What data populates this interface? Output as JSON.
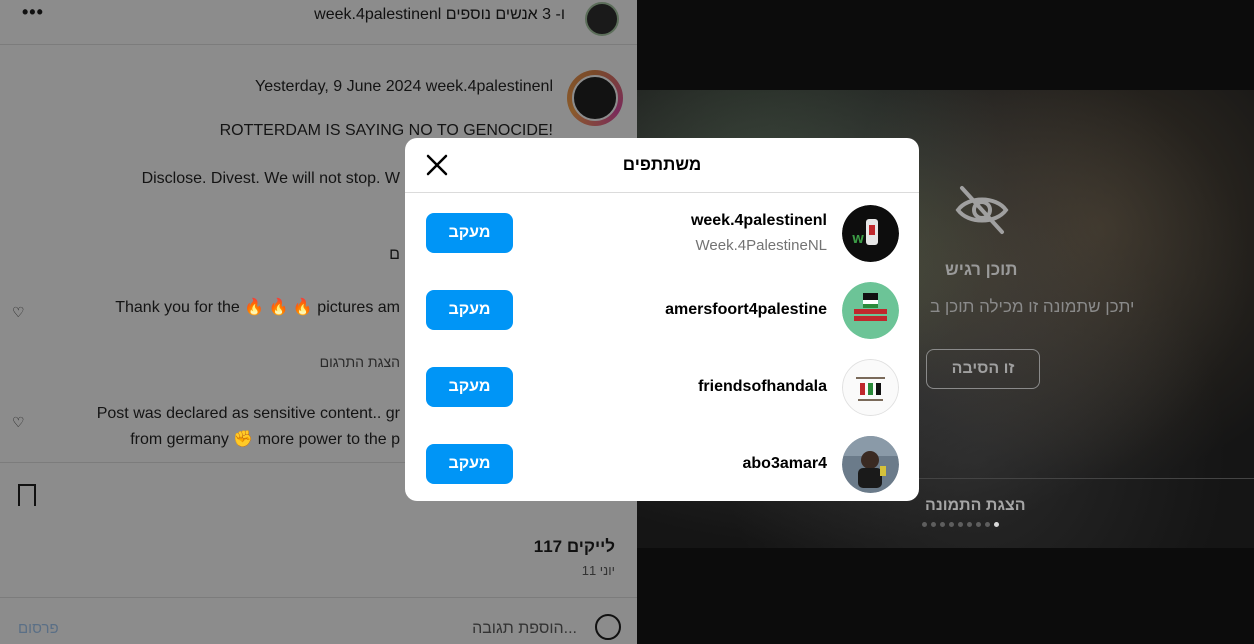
{
  "post_panel": {
    "header_title": "week.4palestinenl ו- 3 אנשים נוספים",
    "more_icon": "more-horizontal-icon",
    "caption": {
      "meta": "Yesterday, 9 June 2024 week.4palestinenl",
      "line1": "ROTTERDAM IS SAYING NO TO GENOCIDE!",
      "line2": "Disclose. Divest. We will not stop. W",
      "hidden_fragment": "ם"
    },
    "comments": [
      {
        "text": "Thank you for the 🔥 🔥 🔥 pictures am",
        "translate": "הצגת התרגום"
      },
      {
        "line1": "Post was declared as sensitive content.. gr",
        "line2": "from germany ✊ more power to the p"
      }
    ],
    "likes": "117 לייקים",
    "date": "11 יוני",
    "comment_placeholder": "הוספת תגובה...",
    "post_label": "פרסום"
  },
  "media": {
    "sensitive_title": "תוכן רגיש",
    "sensitive_desc": "יתכן שתמונה זו מכילה תוכן ב",
    "why_label": "זו הסיבה",
    "show_label": "הצגת התמונה",
    "dots_total": 9,
    "dots_active": 9,
    "eye_icon": "eye-off-icon"
  },
  "modal": {
    "title": "משתתפים",
    "close_icon": "close-icon",
    "people": [
      {
        "username": "week.4palestinenl",
        "fullname": "Week.4PalestineNL",
        "follow": "מעקב"
      },
      {
        "username": "amersfoort4palestine",
        "fullname": "",
        "follow": "מעקב"
      },
      {
        "username": "friendsofhandala",
        "fullname": "",
        "follow": "מעקב"
      },
      {
        "username": "abo3amar4",
        "fullname": "",
        "follow": "מעקב"
      }
    ]
  },
  "colors": {
    "follow_button": "#0095f6",
    "overlay_dim": "#8c8c8c"
  }
}
